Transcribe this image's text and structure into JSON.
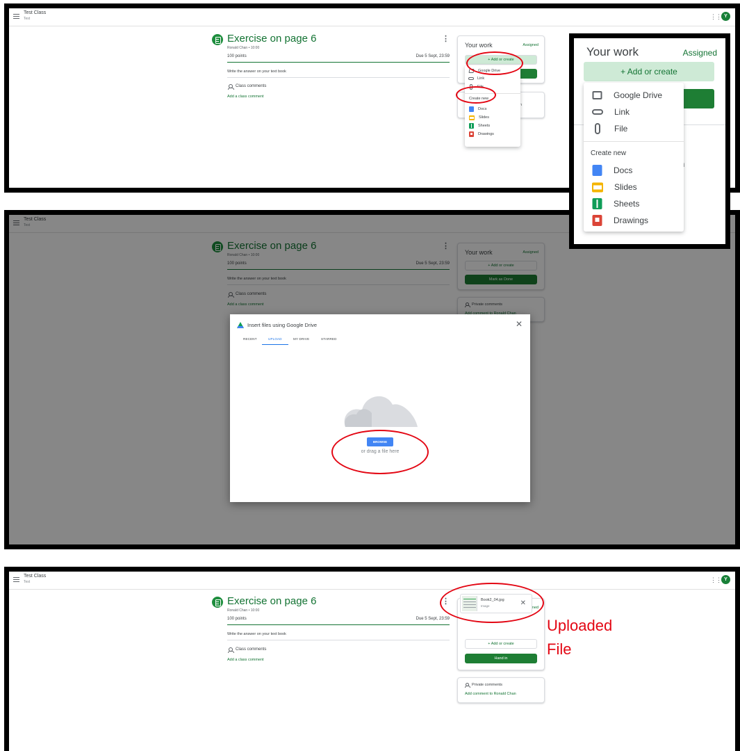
{
  "class": {
    "name": "Test Class",
    "section": "Test",
    "avatar_letter": "Y"
  },
  "assignment": {
    "title": "Exercise on page 6",
    "meta": "Ronald Chan • 10:00",
    "points": "100 points",
    "due": "Due 5 Sept, 23:59",
    "instructions": "Write the answer on your text book",
    "class_comments": "Class comments",
    "add_class_comment": "Add a class comment"
  },
  "your_work": {
    "title": "Your work",
    "status": "Assigned",
    "add_or_create": "+ Add or create",
    "mark_as_done": "Mark as Done",
    "hand_in": "Hand in"
  },
  "private_comments": {
    "title": "Private comments",
    "add": "Add comment to Ronald Chan",
    "truncated": "on"
  },
  "add_menu": {
    "attach": [
      "Google Drive",
      "Link",
      "File"
    ],
    "create_new_header": "Create new",
    "create": [
      "Docs",
      "Slides",
      "Sheets",
      "Drawings"
    ]
  },
  "zoom": {
    "partial_text": "an"
  },
  "drive_dialog": {
    "title": "Insert files using Google Drive",
    "tabs": [
      "RECENT",
      "UPLOAD",
      "MY DRIVE",
      "STARRED"
    ],
    "active_tab": "UPLOAD",
    "browse": "BROWSE",
    "drag_text": "or drag a file here"
  },
  "attachment": {
    "name": "Book2_04.jpg",
    "type": "Image"
  },
  "annotation": {
    "uploaded_line1": "Uploaded",
    "uploaded_line2": "File",
    "color": "#e30613"
  },
  "colors": {
    "green": "#137333",
    "button_green": "#1e7e34",
    "blue": "#4285f4",
    "annotation_red": "#e30613"
  }
}
